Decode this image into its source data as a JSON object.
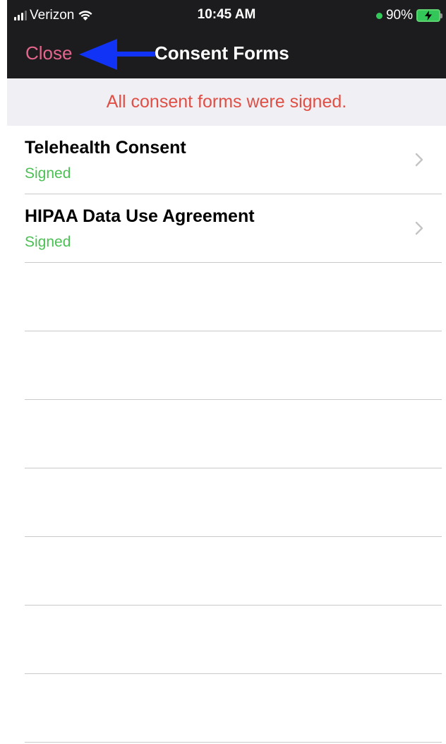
{
  "status_bar": {
    "carrier": "Verizon",
    "time": "10:45 AM",
    "battery": "90%"
  },
  "nav": {
    "close_label": "Close",
    "title": "Consent Forms"
  },
  "banner": {
    "message": "All consent forms were signed."
  },
  "forms": [
    {
      "title": "Telehealth Consent",
      "status": "Signed"
    },
    {
      "title": "HIPAA Data Use Agreement",
      "status": "Signed"
    }
  ],
  "colors": {
    "close": "#e4668d",
    "banner_text": "#e04f45",
    "status_signed": "#4cc055",
    "arrow": "#1033f5"
  },
  "icons": [
    "cellular-signal-icon",
    "wifi-icon",
    "charging-battery-icon",
    "chevron-right-icon",
    "annotation-arrow"
  ]
}
